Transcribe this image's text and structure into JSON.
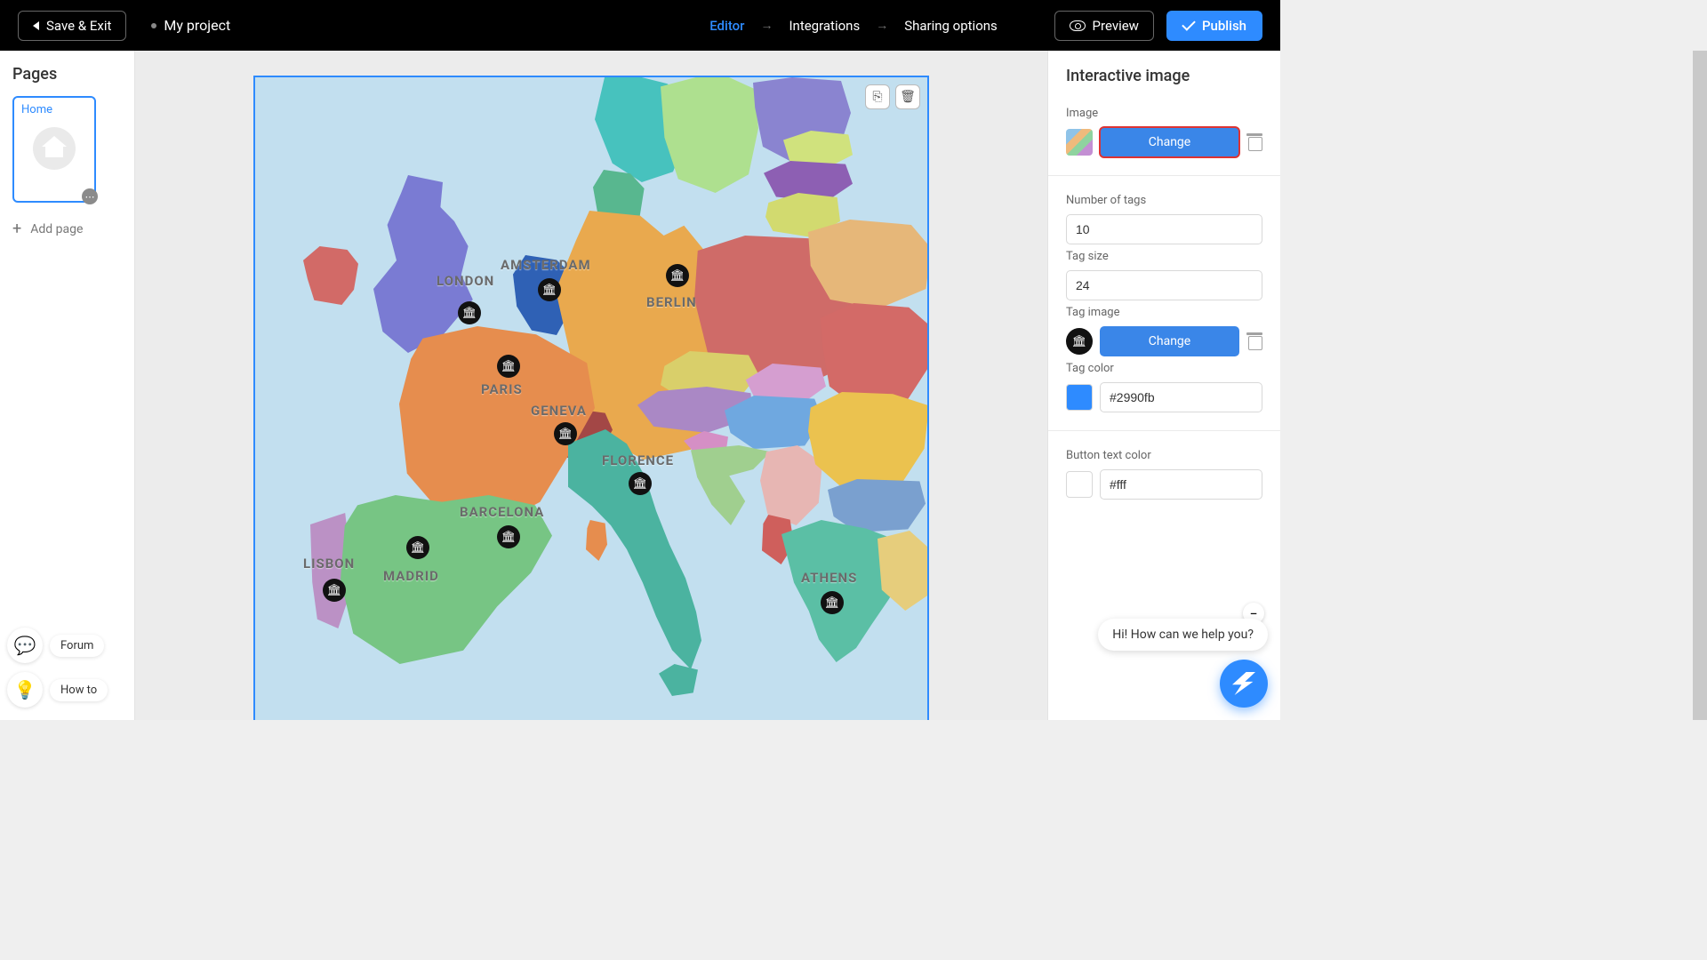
{
  "topbar": {
    "save_exit": "Save & Exit",
    "project_name": "My project",
    "nav": {
      "editor": "Editor",
      "integrations": "Integrations",
      "sharing": "Sharing options"
    },
    "preview": "Preview",
    "publish": "Publish"
  },
  "left": {
    "title": "Pages",
    "home_label": "Home",
    "add_page": "Add page",
    "forum": "Forum",
    "howto": "How to"
  },
  "canvas": {
    "cities": {
      "london": "LONDON",
      "amsterdam": "AMSTERDAM",
      "berlin": "BERLIN",
      "paris": "PARIS",
      "geneva": "GENEVA",
      "florence": "FLORENCE",
      "barcelona": "BARCELONA",
      "madrid": "MADRID",
      "lisbon": "LISBON",
      "athens": "ATHENS"
    }
  },
  "panel": {
    "title": "Interactive image",
    "image_label": "Image",
    "change": "Change",
    "num_tags_label": "Number of tags",
    "num_tags_value": "10",
    "tag_size_label": "Tag size",
    "tag_size_value": "24",
    "tag_image_label": "Tag image",
    "tag_color_label": "Tag color",
    "tag_color_value": "#2990fb",
    "btn_text_color_label": "Button text color",
    "btn_text_color_value": "#fff"
  },
  "chat": {
    "tip": "Hi! How can we help you?"
  }
}
